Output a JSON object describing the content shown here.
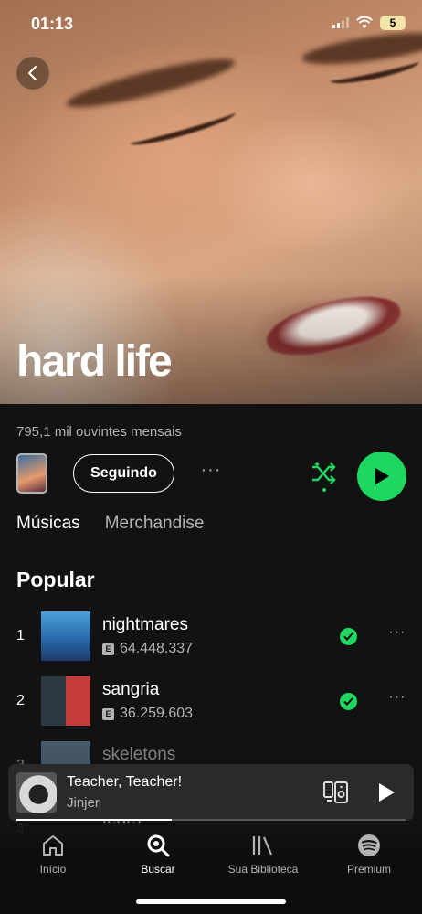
{
  "status_bar": {
    "time": "01:13",
    "battery": "5"
  },
  "artist": {
    "name": "hard life",
    "monthly_listeners": "795,1 mil ouvintes mensais"
  },
  "actions": {
    "follow_label": "Seguindo",
    "more_label": "···"
  },
  "tabs": [
    {
      "label": "Músicas",
      "active": true
    },
    {
      "label": "Merchandise",
      "active": false
    }
  ],
  "popular": {
    "title": "Popular",
    "tracks": [
      {
        "rank": "1",
        "title": "nightmares",
        "explicit": "E",
        "plays": "64.448.337",
        "saved": true
      },
      {
        "rank": "2",
        "title": "sangria",
        "explicit": "E",
        "plays": "36.259.603",
        "saved": true
      },
      {
        "rank": "3",
        "title": "skeletons",
        "explicit": "",
        "plays": "",
        "saved": false
      },
      {
        "rank": "4",
        "title": "tears",
        "explicit": "",
        "plays": "",
        "saved": false
      }
    ]
  },
  "now_playing": {
    "title": "Teacher, Teacher!",
    "artist": "Jinjer",
    "progress": 0.4
  },
  "bottom_nav": [
    {
      "label": "Início",
      "icon": "home-icon",
      "active": false
    },
    {
      "label": "Buscar",
      "icon": "search-icon",
      "active": true
    },
    {
      "label": "Sua Biblioteca",
      "icon": "library-icon",
      "active": false
    },
    {
      "label": "Premium",
      "icon": "spotify-icon",
      "active": false
    }
  ],
  "colors": {
    "accent": "#1ed760",
    "background": "#121212",
    "muted_text": "#b3b3b3"
  }
}
